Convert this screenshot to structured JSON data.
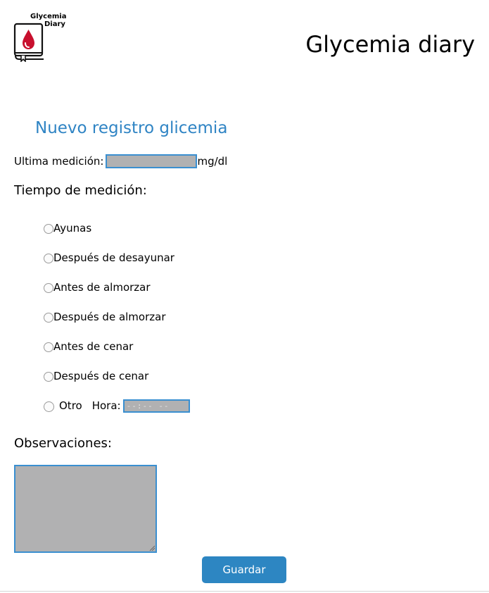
{
  "header": {
    "logo_line1": "Glycemia",
    "logo_line2": "Diary",
    "title": "Glycemia diary"
  },
  "form": {
    "title": "Nuevo registro glicemia",
    "last_measurement_label": "Ultima medición:",
    "last_measurement_value": "",
    "last_measurement_unit": "mg/dl",
    "timing_label": "Tiempo de medición:",
    "options": [
      {
        "label": "Ayunas",
        "selected": false
      },
      {
        "label": "Después de desayunar",
        "selected": false
      },
      {
        "label": "Antes de almorzar",
        "selected": false
      },
      {
        "label": "Después de almorzar",
        "selected": false
      },
      {
        "label": "Antes de cenar",
        "selected": false
      },
      {
        "label": "Después de cenar",
        "selected": false
      },
      {
        "label": "Otro",
        "selected": false
      }
    ],
    "hora_label": "Hora:",
    "hora_placeholder": "--:-- --",
    "notes_label": "Observaciones:",
    "notes_value": "",
    "save_label": "Guardar"
  },
  "colors": {
    "accent": "#2f84c4",
    "button": "#2d86c2",
    "field_bg": "#b1b1b2",
    "field_border": "#3a8fd0",
    "logo_drop": "#c8102e"
  }
}
